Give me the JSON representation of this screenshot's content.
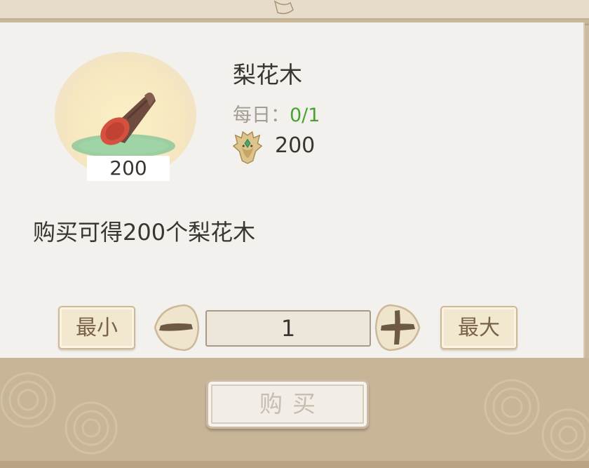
{
  "item": {
    "name": "梨花木",
    "icon": "wood-log-icon",
    "bundle_count": "200",
    "daily_label": "每日：",
    "daily_value": "0/1",
    "price_currency_icon": "dragon-coin-icon",
    "price_value": "200",
    "description": "购买可得200个梨花木"
  },
  "quantity": {
    "min_label": "最小",
    "max_label": "最大",
    "value": "1"
  },
  "buy_button": {
    "label": "购买"
  },
  "colors": {
    "panel": "#f3f1ed",
    "frame": "#cdbba0",
    "daily_value": "#4aa132",
    "button_fill": "#f2e7cf",
    "text": "#3a3530"
  }
}
